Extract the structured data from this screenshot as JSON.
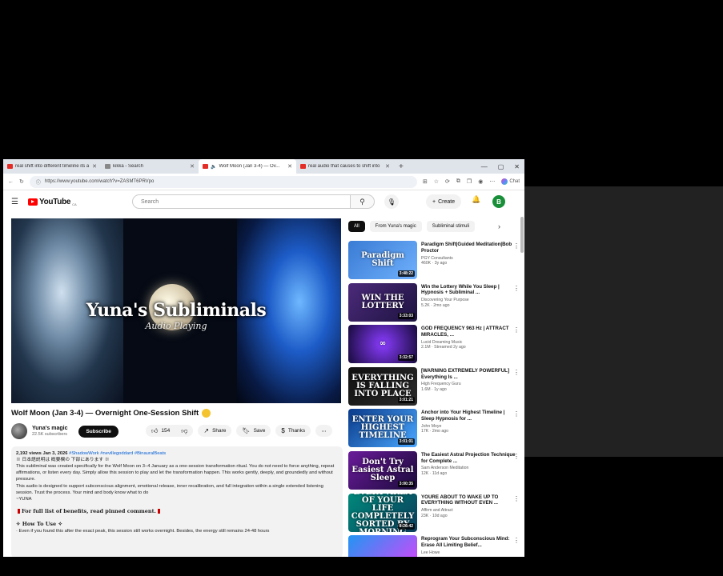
{
  "browser": {
    "tabs": [
      {
        "title": "real shift into different timeline its a",
        "active": false,
        "fav_color": "#e52d27"
      },
      {
        "title": "kikka - Search",
        "active": false,
        "fav_color": "#888888"
      },
      {
        "title": "Wolf Moon (Jan 3-4) — Ov...",
        "active": true,
        "fav_color": "#e52d27"
      },
      {
        "title": "real audio that causes to shift into",
        "active": false,
        "fav_color": "#e52d27"
      }
    ],
    "new_tab": "+",
    "controls": {
      "minimize": "—",
      "maximize": "▢",
      "close": "✕"
    },
    "url": "https://www.youtube.com/watch?v=ZASMT6PRVpo",
    "chat_label": "Chat"
  },
  "youtube": {
    "logo": "YouTube",
    "logo_region": "CA",
    "search_placeholder": "Search",
    "create_label": "Create",
    "avatar_letter": "B"
  },
  "player": {
    "overlay_title": "Yuna's Subliminals",
    "overlay_subtitle": "Audio Playing"
  },
  "video": {
    "title": "Wolf Moon (Jan 3-4) — Overnight One-Session Shift",
    "channel_name": "Yuna's magic",
    "subscribers": "22.5K subscribers",
    "subscribe_label": "Subscribe",
    "likes": "154",
    "share_label": "Share",
    "save_label": "Save",
    "thanks_label": "Thanks",
    "description": {
      "meta": "2,192 views  Jan 3, 2026",
      "tags": "#ShadowWork #nevillegoddard #BinauralBeats",
      "jp_line": "※ 日本語説明は 概要欄の 下部にあります ※",
      "line1": "This subliminal was created specifically for the Wolf Moon on 3–4 January as a one-session transformation ritual. You do not need to force anything, repeat affirmations, or listen every day. Simply allow this session to play and let the transformation happen. This works gently, deeply, and groundedly and without pressure.",
      "line2": "This audio is designed to support subconscious alignment, emotional release, inner recalibration, and full integration within a single extended listening session. Trust the process. Your mind and body know what to do",
      "signoff": "~YUNA",
      "pinned": "For full list of benefits, read pinned comment.",
      "howto": "✧ How To Use ✧",
      "howto_line": "· Even if you found this after the exact peak, this session still works overnight. Besides, the energy still remains 24-48 hours"
    }
  },
  "chips": [
    "All",
    "From Yuna's magic",
    "Subliminal stimuli"
  ],
  "recommendations": [
    {
      "title": "Paradigm Shift|Guided Meditation|Bob Proctor",
      "channel": "PGY Consultants",
      "stats": "460K  ·  3y ago",
      "duration": "3:48:22",
      "thumb_text": "Paradigm Shift",
      "bg": "linear-gradient(135deg,#3a7bd5,#6fb1fc)"
    },
    {
      "title": "Win the Lottery While You Sleep | Hypnosis + Subliminal ...",
      "channel": "Discovering Your Purpose",
      "stats": "5.2K  ·  2mo ago",
      "duration": "3:33:03",
      "thumb_text": "WIN THE LOTTERY",
      "bg": "linear-gradient(135deg,#4b2a7a,#1d1340)"
    },
    {
      "title": "GOD FREQUENCY 963 Hz | ATTRACT MIRACLES, ...",
      "channel": "Lucid Dreaming Music",
      "stats": "2.1M  ·  Streamed 2y ago",
      "duration": "3:32:57",
      "thumb_text": "∞",
      "bg": "radial-gradient(circle,#8a3cff,#160a3a)"
    },
    {
      "title": "[WARNING EXTREMELY POWERFUL] Everything Is ...",
      "channel": "High Frequency Guru",
      "stats": "1.6M  ·  1y ago",
      "duration": "3:01:21",
      "thumb_text": "EVERYTHING IS FALLING INTO PLACE",
      "bg": "linear-gradient(135deg,#111,#2b2b2b)"
    },
    {
      "title": "Anchor into Your Highest Timeline | Sleep Hypnosis for ...",
      "channel": "John Moye",
      "stats": "17K  ·  2mo ago",
      "duration": "3:01:01",
      "thumb_text": "ENTER YOUR HIGHEST TIMELINE",
      "bg": "linear-gradient(135deg,#0a3a8a,#4aa8ff)"
    },
    {
      "title": "The Easiest Astral Projection Technique for Complete ...",
      "channel": "Sam Anderson Meditation",
      "stats": "12K  ·  11d ago",
      "duration": "3:00:35",
      "thumb_text": "Don't Try Easiest Astral Sleep",
      "bg": "linear-gradient(135deg,#6a1b9a,#1a0b3a)"
    },
    {
      "title": "YOURE ABOUT TO WAKE UP TO EVERYTHING WITHOUT EVEN ...",
      "channel": "Affirm and Attract",
      "stats": "23K  ·  10d ago",
      "duration": "8:26:42",
      "thumb_text": "EVERY AREA OF YOUR LIFE COMPLETELY SORTED BY MORNING",
      "bg": "linear-gradient(135deg,#00897b,#0b3d5c)"
    },
    {
      "title": "Reprogram Your Subconscious Mind: Erase All Limiting Belief...",
      "channel": "Lee Howe",
      "stats": "",
      "duration": "",
      "thumb_text": "",
      "bg": "linear-gradient(135deg,#2196f3,#e040fb)"
    }
  ]
}
